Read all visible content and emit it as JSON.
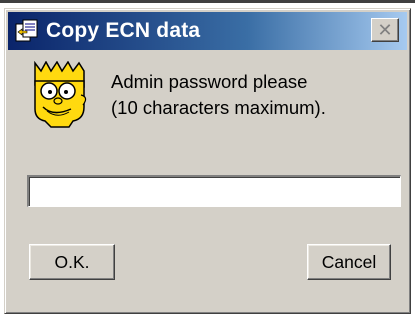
{
  "window": {
    "title": "Copy ECN data",
    "title_icon": "copy-document-icon",
    "close_glyph": "✕",
    "colors": {
      "titlebar_start": "#0a246a",
      "titlebar_end": "#a6caf0",
      "face": "#d4d0c8"
    }
  },
  "dialog": {
    "avatar_icon": "bart-simpson-icon",
    "message_line1": "Admin password please",
    "message_line2": "(10 characters maximum).",
    "password_value": ""
  },
  "buttons": {
    "ok_label": "O.K.",
    "cancel_label": "Cancel"
  }
}
